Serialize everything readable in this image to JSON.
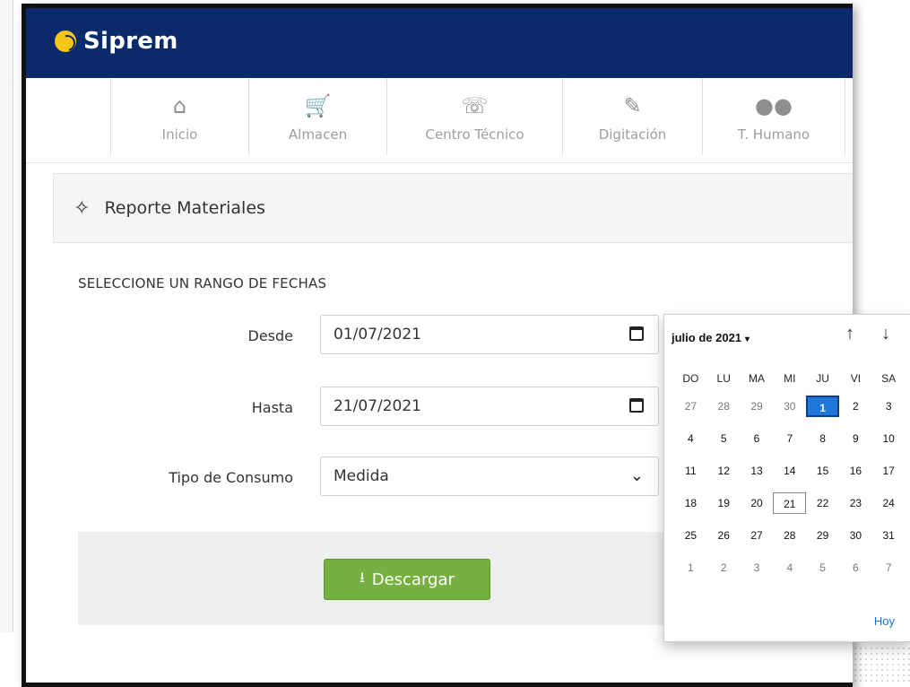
{
  "app": {
    "title": "Siprem"
  },
  "nav": [
    {
      "label": "Inicio",
      "icon": "home-icon"
    },
    {
      "label": "Almacen",
      "icon": "cart-icon"
    },
    {
      "label": "Centro Técnico",
      "icon": "phone-icon"
    },
    {
      "label": "Digitación",
      "icon": "pencil-icon"
    },
    {
      "label": "T. Humano",
      "icon": "users-icon"
    }
  ],
  "section": {
    "title": "Reporte Materiales",
    "icon": "crosshairs-icon"
  },
  "form": {
    "range_title": "SELECCIONE UN RANGO DE FECHAS",
    "desde_label": "Desde",
    "desde_value": "01/07/2021",
    "hasta_label": "Hasta",
    "hasta_value": "21/07/2021",
    "tipo_label": "Tipo de Consumo",
    "tipo_value": "Medida",
    "download_label": "Descargar"
  },
  "datepicker": {
    "month_label": "julio de 2021",
    "weekdays": [
      "DO",
      "LU",
      "MA",
      "MI",
      "JU",
      "VI",
      "SA"
    ],
    "weeks": [
      [
        "27",
        "28",
        "29",
        "30",
        "1",
        "2",
        "3"
      ],
      [
        "4",
        "5",
        "6",
        "7",
        "8",
        "9",
        "10"
      ],
      [
        "11",
        "12",
        "13",
        "14",
        "15",
        "16",
        "17"
      ],
      [
        "18",
        "19",
        "20",
        "21",
        "22",
        "23",
        "24"
      ],
      [
        "25",
        "26",
        "27",
        "28",
        "29",
        "30",
        "31"
      ],
      [
        "1",
        "2",
        "3",
        "4",
        "5",
        "6",
        "7"
      ]
    ],
    "selected": "1",
    "today": "21",
    "today_label": "Hoy"
  },
  "colors": {
    "topbar": "#0b2a6b",
    "logo": "#f5c518",
    "download_button": "#76b041",
    "selected_day": "#1e77d9"
  }
}
